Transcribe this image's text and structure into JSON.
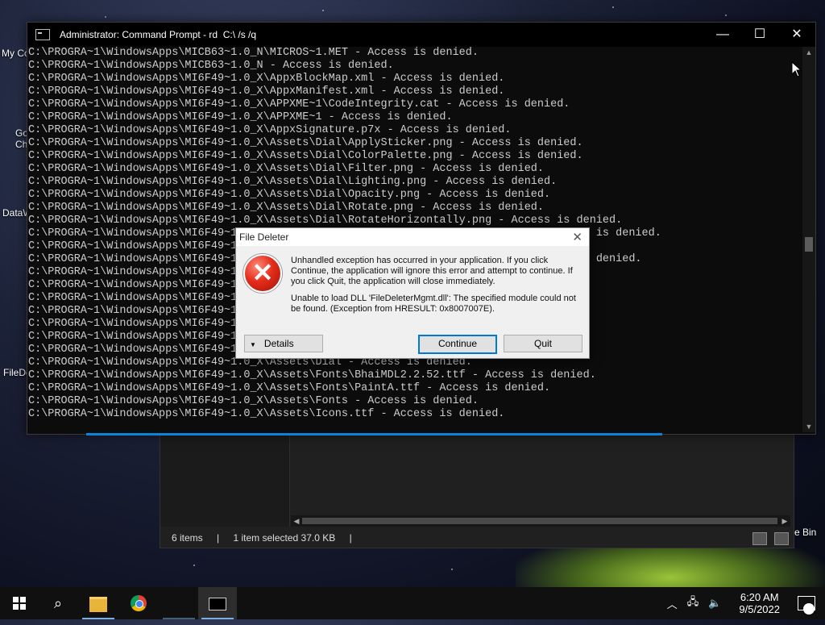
{
  "desktop": {
    "icons": [
      {
        "label": "My Co"
      },
      {
        "label": "Go"
      },
      {
        "label": "Ch"
      },
      {
        "label": "DataW"
      },
      {
        "label": "FileDe"
      },
      {
        "label": "e Bin"
      }
    ]
  },
  "cmd": {
    "title": "Administrator: Command Prompt - rd  C:\\ /s /q",
    "minimize_glyph": "—",
    "maximize_glyph": "☐",
    "close_glyph": "✕",
    "lines": [
      "C:\\PROGRA~1\\WindowsApps\\MICB63~1.0_N\\MICROS~1.MET - Access is denied.",
      "C:\\PROGRA~1\\WindowsApps\\MICB63~1.0_N - Access is denied.",
      "C:\\PROGRA~1\\WindowsApps\\MI6F49~1.0_X\\AppxBlockMap.xml - Access is denied.",
      "C:\\PROGRA~1\\WindowsApps\\MI6F49~1.0_X\\AppxManifest.xml - Access is denied.",
      "C:\\PROGRA~1\\WindowsApps\\MI6F49~1.0_X\\APPXME~1\\CodeIntegrity.cat - Access is denied.",
      "C:\\PROGRA~1\\WindowsApps\\MI6F49~1.0_X\\APPXME~1 - Access is denied.",
      "C:\\PROGRA~1\\WindowsApps\\MI6F49~1.0_X\\AppxSignature.p7x - Access is denied.",
      "C:\\PROGRA~1\\WindowsApps\\MI6F49~1.0_X\\Assets\\Dial\\ApplySticker.png - Access is denied.",
      "C:\\PROGRA~1\\WindowsApps\\MI6F49~1.0_X\\Assets\\Dial\\ColorPalette.png - Access is denied.",
      "C:\\PROGRA~1\\WindowsApps\\MI6F49~1.0_X\\Assets\\Dial\\Filter.png - Access is denied.",
      "C:\\PROGRA~1\\WindowsApps\\MI6F49~1.0_X\\Assets\\Dial\\Lighting.png - Access is denied.",
      "C:\\PROGRA~1\\WindowsApps\\MI6F49~1.0_X\\Assets\\Dial\\Opacity.png - Access is denied.",
      "C:\\PROGRA~1\\WindowsApps\\MI6F49~1.0_X\\Assets\\Dial\\Rotate.png - Access is denied.",
      "C:\\PROGRA~1\\WindowsApps\\MI6F49~1.0_X\\Assets\\Dial\\RotateHorizontally.png - Access is denied.",
      "C:\\PROGRA~1\\WindowsApps\\MI6F49~1                                                       is denied.",
      "C:\\PROGRA~1\\WindowsApps\\MI6F49~1                                                   d.",
      "C:\\PROGRA~1\\WindowsApps\\MI6F49~1                                                     s denied.",
      "C:\\PROGRA~1\\WindowsApps\\MI6F49~1",
      "C:\\PROGRA~1\\WindowsApps\\MI6F49~1",
      "C:\\PROGRA~1\\WindowsApps\\MI6F49~1",
      "C:\\PROGRA~1\\WindowsApps\\MI6F49~1",
      "C:\\PROGRA~1\\WindowsApps\\MI6F49~1",
      "C:\\PROGRA~1\\WindowsApps\\MI6F49~1",
      "C:\\PROGRA~1\\WindowsApps\\MI6F49~1",
      "C:\\PROGRA~1\\WindowsApps\\MI6F49~1.0_X\\Assets\\Dial - Access is denied.",
      "C:\\PROGRA~1\\WindowsApps\\MI6F49~1.0_X\\Assets\\Fonts\\BhaiMDL2.2.52.ttf - Access is denied.",
      "C:\\PROGRA~1\\WindowsApps\\MI6F49~1.0_X\\Assets\\Fonts\\PaintA.ttf - Access is denied.",
      "C:\\PROGRA~1\\WindowsApps\\MI6F49~1.0_X\\Assets\\Fonts - Access is denied.",
      "C:\\PROGRA~1\\WindowsApps\\MI6F49~1.0_X\\Assets\\Icons.ttf - Access is denied."
    ]
  },
  "dialog": {
    "title": "File Deleter",
    "close_glyph": "✕",
    "icon_glyph": "✕",
    "message1": "Unhandled exception has occurred in your application. If you click Continue, the application will ignore this error and attempt to continue. If you click Quit, the application will close immediately.",
    "message2": "Unable to load DLL 'FileDeleterMgmt.dll': The specified module could not be found. (Exception from HRESULT: 0x8007007E).",
    "details_label": "Details",
    "details_glyph": "▼",
    "continue_label": "Continue",
    "quit_label": "Quit"
  },
  "explorer": {
    "items_count": "6 items",
    "sep": "|",
    "selected": "1 item selected  37.0 KB",
    "scroll_left": "◀",
    "scroll_right": "▶"
  },
  "taskbar": {
    "search_glyph": "⌕",
    "tray_chevron": "︿",
    "network_glyph": "🖧",
    "volume_glyph": "🔈",
    "time": "6:20 AM",
    "date": "9/5/2022",
    "notification_count": "1"
  },
  "colors": {
    "console_text": "#cccccc",
    "console_bg": "#0c0c0c",
    "accent": "#0078d7",
    "error_red": "#e42d1a"
  }
}
